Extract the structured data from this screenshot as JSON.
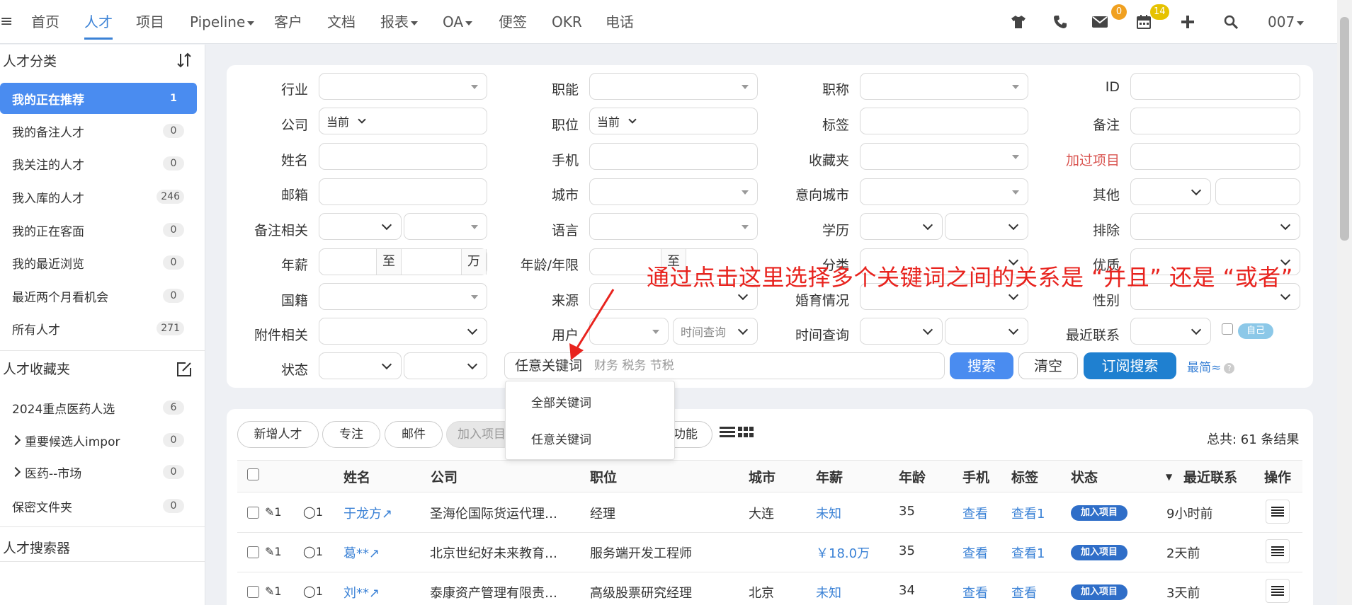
{
  "nav": {
    "items": [
      "首页",
      "人才",
      "项目",
      "Pipeline",
      "客户",
      "文档",
      "报表",
      "OA",
      "便签",
      "OKR",
      "电话"
    ],
    "badge_mail": "0",
    "badge_calendar": "14",
    "user": "007"
  },
  "sidebar": {
    "section1_title": "人才分类",
    "items": [
      {
        "label": "我的正在推荐",
        "count": "1"
      },
      {
        "label": "我的备注人才",
        "count": "0"
      },
      {
        "label": "我关注的人才",
        "count": "0"
      },
      {
        "label": "我入库的人才",
        "count": "246"
      },
      {
        "label": "我的正在客面",
        "count": "0"
      },
      {
        "label": "我的最近浏览",
        "count": "0"
      },
      {
        "label": "最近两个月看机会",
        "count": "0"
      },
      {
        "label": "所有人才",
        "count": "271"
      }
    ],
    "section2_title": "人才收藏夹",
    "folders": [
      {
        "label": "2024重点医药人选",
        "count": "6"
      },
      {
        "label": "重要候选人impor",
        "count": "0"
      },
      {
        "label": "医药--市场",
        "count": "0"
      },
      {
        "label": "保密文件夹",
        "count": "0"
      }
    ],
    "section3_title": "人才搜索器"
  },
  "filters": {
    "industry": "行业",
    "function": "职能",
    "title": "职称",
    "id": "ID",
    "company": "公司",
    "company_value": "当前",
    "position": "职位",
    "position_value": "当前",
    "tags": "标签",
    "remark": "备注",
    "name": "姓名",
    "phone": "手机",
    "favorites": "收藏夹",
    "joined_project": "加过项目",
    "email": "邮箱",
    "city": "城市",
    "intended_city": "意向城市",
    "other": "其他",
    "remark_related": "备注相关",
    "language": "语言",
    "education": "学历",
    "exclude": "排除",
    "salary": "年薪",
    "salary_to": "至",
    "salary_unit": "万",
    "age": "年龄/年限",
    "age_to": "至",
    "category": "分类",
    "strength": "优质",
    "nationality": "国籍",
    "source": "来源",
    "marital": "婚育情况",
    "gender": "性别",
    "attachment": "附件相关",
    "user": "用户",
    "time_query_inline": "时间查询",
    "time_query": "时间查询",
    "recent_contact": "最近联系",
    "self_tag": "自己",
    "status": "状态",
    "keyword_mode": "任意关键词",
    "keyword_value": "财务 税务 节税",
    "search_btn": "搜索",
    "clear_btn": "清空",
    "subscribe_btn": "订阅搜索",
    "simple_link": "最简",
    "help": "?"
  },
  "dropdown": {
    "options": [
      "全部关键词",
      "任意关键词"
    ]
  },
  "annotation": "通过点击这里选择多个关键词之间的关系是 “并且” 还是 “或者”",
  "toolbar": {
    "add": "新增人才",
    "focus": "专注",
    "mail": "邮件",
    "join": "加入项目",
    "more": "功能",
    "total": "总共: 61 条结果"
  },
  "table": {
    "headers": [
      "姓名",
      "公司",
      "职位",
      "城市",
      "年薪",
      "年龄",
      "手机",
      "标签",
      "状态",
      "最近联系",
      "操作"
    ],
    "rows": [
      {
        "attach": "1",
        "comments": "1",
        "name": "于龙方",
        "company": "圣海伦国际货运代理…",
        "position": "经理",
        "city": "大连",
        "salary": "未知",
        "age": "35",
        "phone": "查看",
        "tags": "查看1",
        "status": "加入项目",
        "recent": "9小时前"
      },
      {
        "attach": "1",
        "comments": "1",
        "name": "葛**",
        "company": "北京世纪好未来教育…",
        "position": "服务端开发工程师",
        "city": "",
        "salary": "￥18.0万",
        "age": "35",
        "phone": "查看",
        "tags": "查看1",
        "status": "加入项目",
        "recent": "2天前"
      },
      {
        "attach": "1",
        "comments": "1",
        "name": "刘**",
        "company": "泰康资产管理有限责…",
        "position": "高级股票研究经理",
        "city": "北京",
        "salary": "未知",
        "age": "34",
        "phone": "查看",
        "tags": "查看",
        "status": "加入项目",
        "recent": "3天前"
      }
    ]
  }
}
